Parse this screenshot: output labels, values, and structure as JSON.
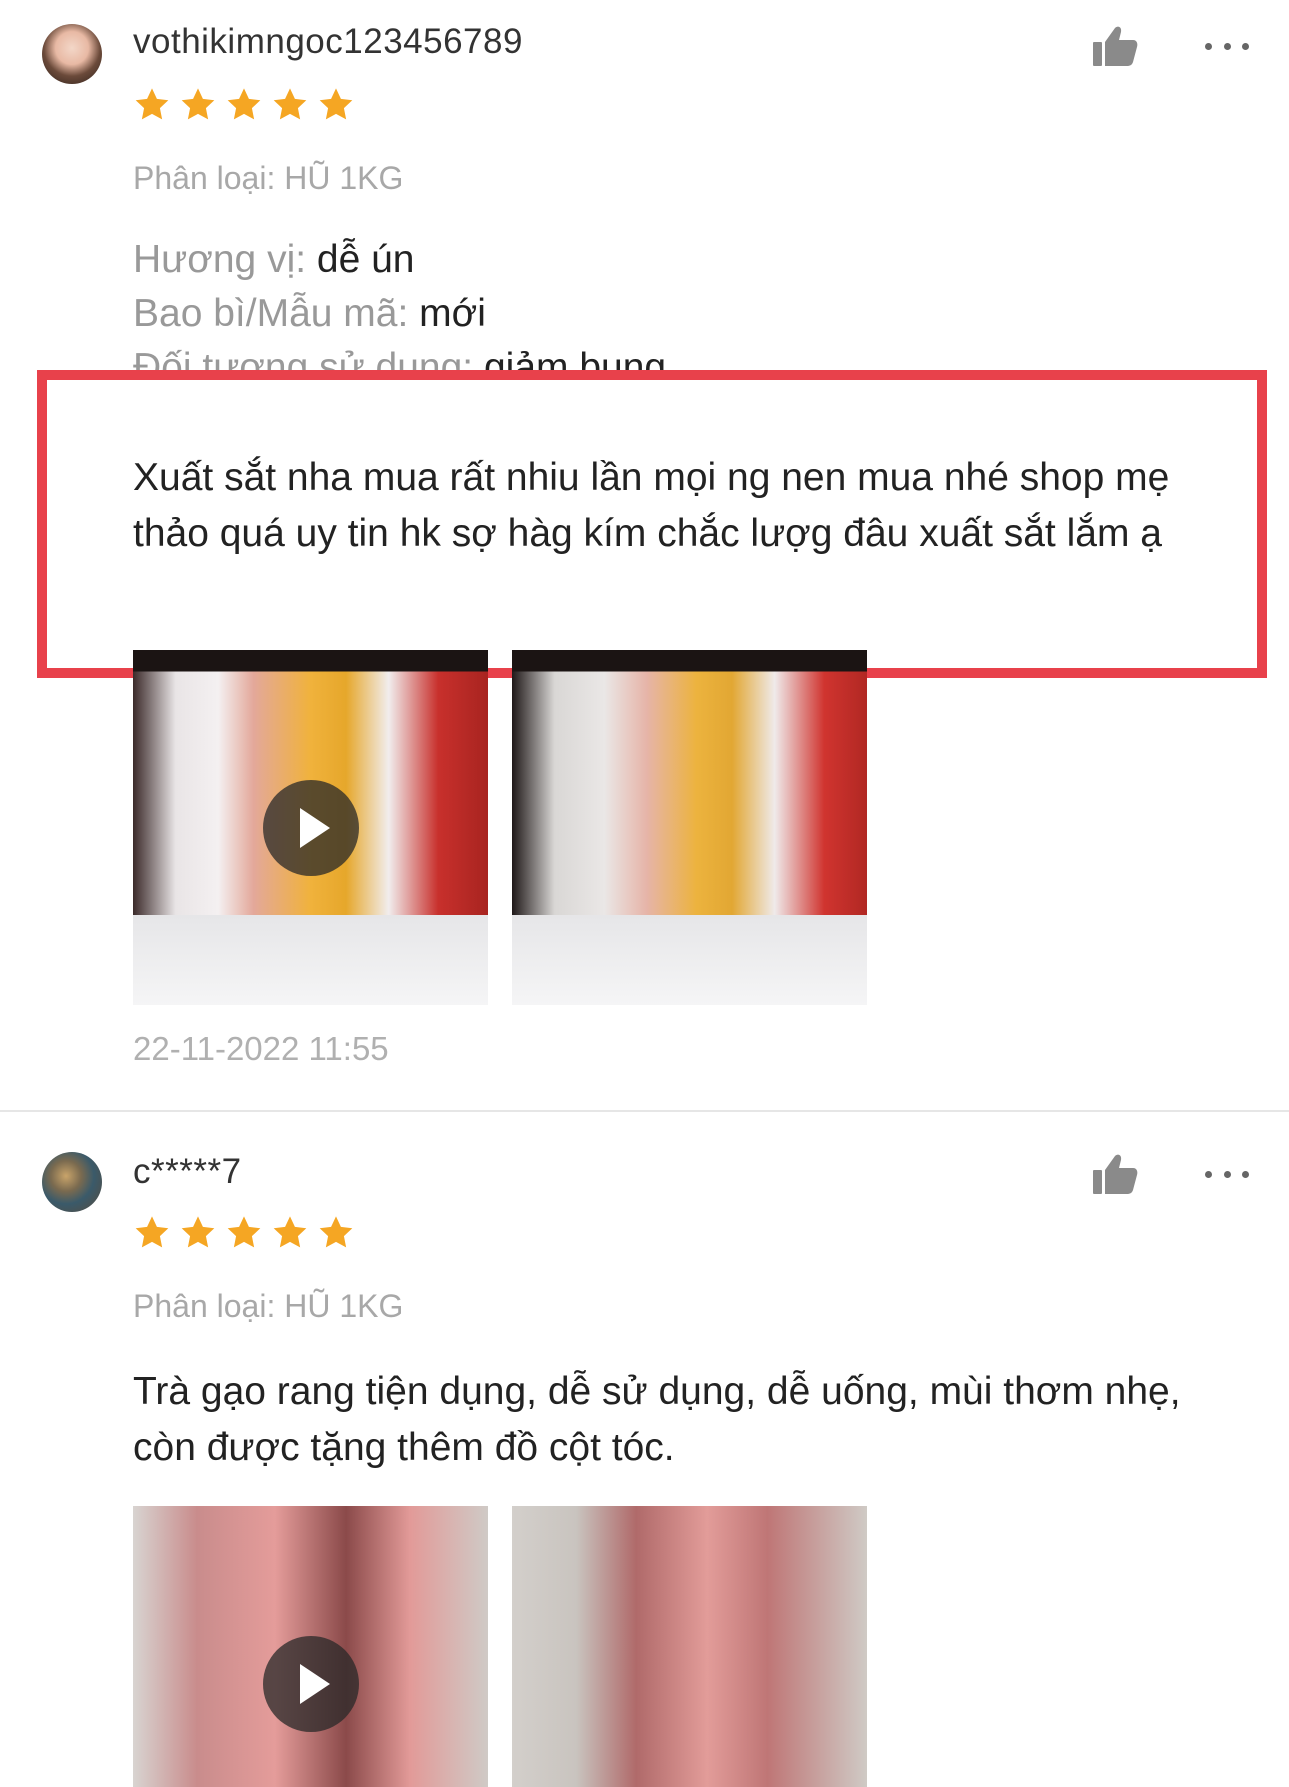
{
  "colors": {
    "star": "#f5a623",
    "highlight_border": "#e8414b",
    "muted_text": "#a8a8a8"
  },
  "reviews": [
    {
      "username": "vothikimngoc123456789",
      "rating": 5,
      "variant": "Phân loại: HŨ 1KG",
      "attributes": [
        {
          "key": "Hương vị:",
          "value": "dễ ún"
        },
        {
          "key": "Bao bì/Mẫu mã:",
          "value": "mới"
        },
        {
          "key": "Đối tượng sử dụng:",
          "value": "giảm bụng"
        }
      ],
      "comment": "Xuất sắt nha mua rất nhiu lần mọi ng nen mua nhé shop mẹ thảo quá uy tin hk sợ hàg kím chắc lượg đâu xuất sắt lắm ạ",
      "timestamp": "22-11-2022 11:55",
      "icons": {
        "like": "thumbs-up-icon",
        "more": "more-options-icon",
        "play": "play-icon"
      }
    },
    {
      "username": "c*****7",
      "rating": 5,
      "variant": "Phân loại: HŨ 1KG",
      "comment": "Trà gạo rang tiện dụng, dễ sử dụng, dễ uống, mùi thơm nhẹ, còn được tặng thêm đồ cột tóc.",
      "icons": {
        "like": "thumbs-up-icon",
        "more": "more-options-icon",
        "play": "play-icon"
      }
    }
  ]
}
